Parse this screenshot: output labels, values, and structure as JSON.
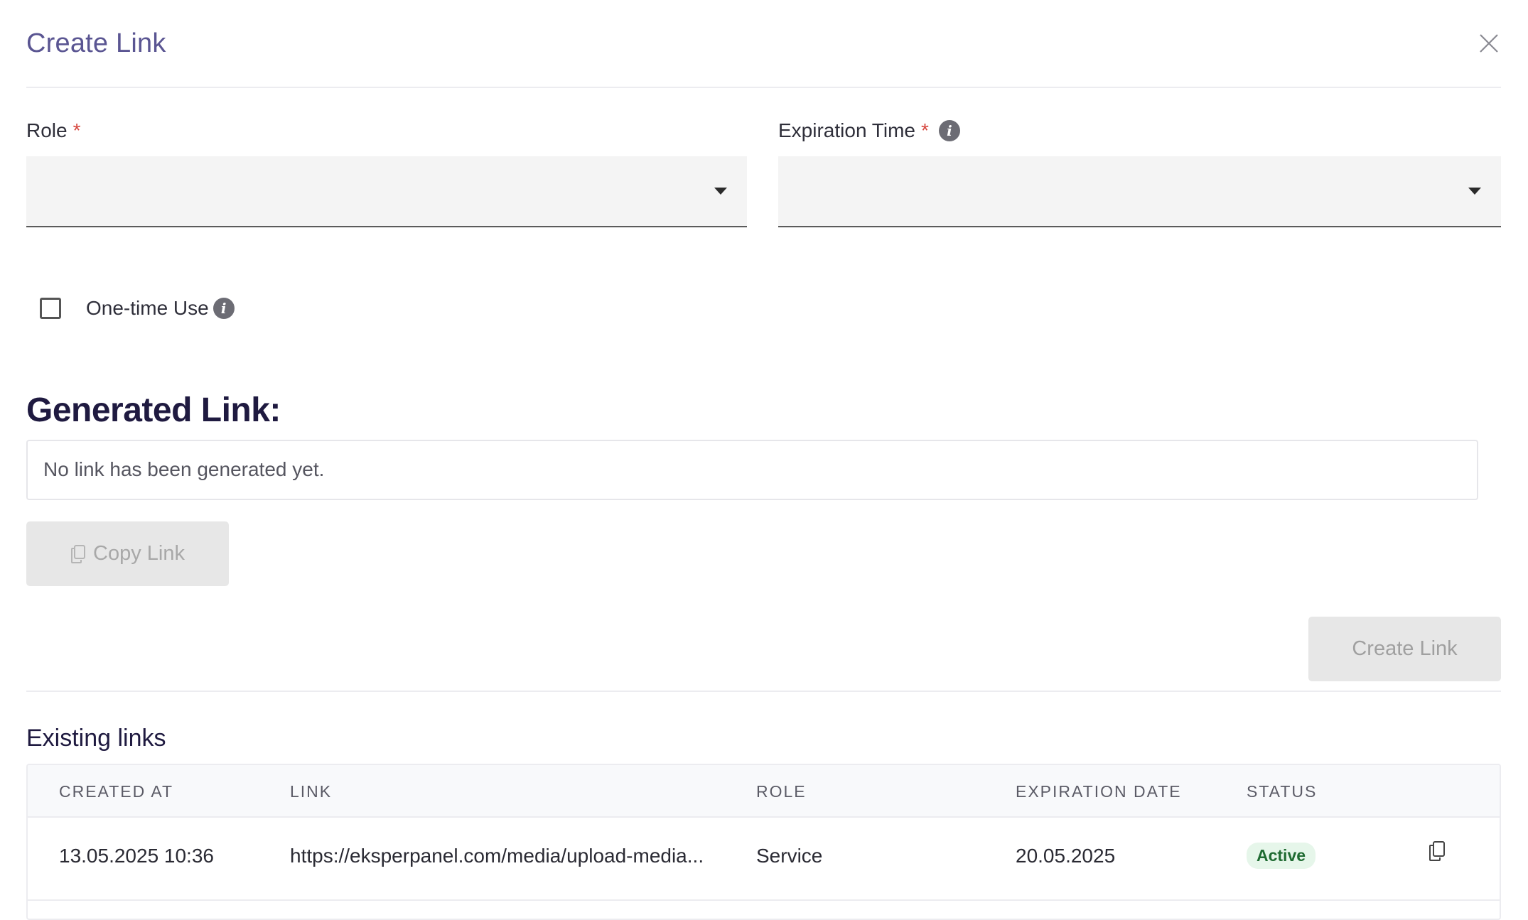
{
  "modal": {
    "title": "Create Link"
  },
  "form": {
    "role_label": "Role",
    "expiration_label": "Expiration Time",
    "required_mark": "*",
    "role_value": "",
    "expiration_value": "",
    "one_time_label": "One-time Use",
    "one_time_checked": false
  },
  "generated": {
    "title": "Generated Link:",
    "placeholder": "No link has been generated yet.",
    "copy_button": "Copy Link"
  },
  "actions": {
    "create_button": "Create Link"
  },
  "existing": {
    "title": "Existing links",
    "columns": [
      "CREATED AT",
      "LINK",
      "ROLE",
      "EXPIRATION DATE",
      "STATUS"
    ],
    "rows": [
      {
        "created_at": "13.05.2025 10:36",
        "link": "https://eksperpanel.com/media/upload-media...",
        "role": "Service",
        "expiration_date": "20.05.2025",
        "status": "Active"
      }
    ]
  },
  "icons": {
    "close": "close-icon",
    "info": "info-icon",
    "caret": "chevron-down-icon",
    "copy": "copy-icon"
  },
  "colors": {
    "title": "#5a5592",
    "required": "#d6453d",
    "heading": "#1f1a40",
    "status_active_bg": "#e6f6ea",
    "status_active_text": "#1f6b32"
  }
}
